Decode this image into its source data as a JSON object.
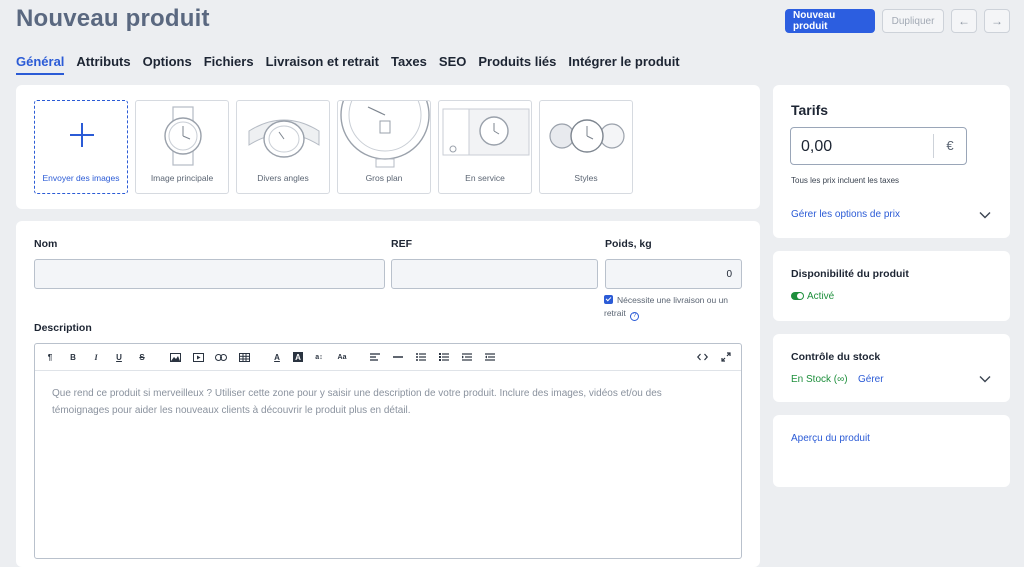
{
  "page": {
    "title": "Nouveau produit"
  },
  "actions": {
    "new_product": "Nouveau produit",
    "duplicate": "Dupliquer",
    "prev": "←",
    "next": "→"
  },
  "tabs": [
    {
      "label": "Général",
      "active": true
    },
    {
      "label": "Attributs"
    },
    {
      "label": "Options"
    },
    {
      "label": "Fichiers"
    },
    {
      "label": "Livraison et retrait"
    },
    {
      "label": "Taxes"
    },
    {
      "label": "SEO"
    },
    {
      "label": "Produits liés"
    },
    {
      "label": "Intégrer le produit"
    }
  ],
  "images": {
    "upload_label": "Envoyer des images",
    "tiles": [
      {
        "label": "Image principale",
        "icon": "watch-icon"
      },
      {
        "label": "Divers angles",
        "icon": "watch-angle-icon"
      },
      {
        "label": "Gros plan",
        "icon": "watch-closeup-icon"
      },
      {
        "label": "En service",
        "icon": "watch-inuse-icon"
      },
      {
        "label": "Styles",
        "icon": "watch-styles-icon"
      }
    ]
  },
  "form": {
    "name_label": "Nom",
    "name_value": "",
    "ref_label": "REF",
    "ref_value": "",
    "weight_label": "Poids, kg",
    "weight_value": "0",
    "shipping_check": "Nécessite une livraison ou un retrait",
    "help": "?",
    "description_label": "Description",
    "description_placeholder": "Que rend ce produit si merveilleux ? Utiliser cette zone pour y saisir une description de votre produit. Inclure des images, vidéos et/ou des témoignages pour aider les nouveaux clients à découvrir le produit plus en détail."
  },
  "editor_toolbar": {
    "paragraph": "¶",
    "bold": "B",
    "italic": "I",
    "underline": "U",
    "strike": "S",
    "font_color": "A",
    "bg_color": "A",
    "font_size": "a↕",
    "case": "Aa"
  },
  "sidebar": {
    "tarifs": {
      "title": "Tarifs",
      "price": "0,00",
      "currency": "€",
      "note": "Tous les prix incluent les taxes",
      "options_link": "Gérer les options de prix"
    },
    "dispo": {
      "title": "Disponibilité du produit",
      "status": "Activé"
    },
    "stock": {
      "title": "Contrôle du stock",
      "status": "En Stock (∞)",
      "manage": "Gérer"
    },
    "apercu": {
      "link": "Aperçu du produit"
    }
  },
  "colors": {
    "accent": "#2b5bd6",
    "success": "#1e8f3c",
    "title": "#5a6880"
  }
}
